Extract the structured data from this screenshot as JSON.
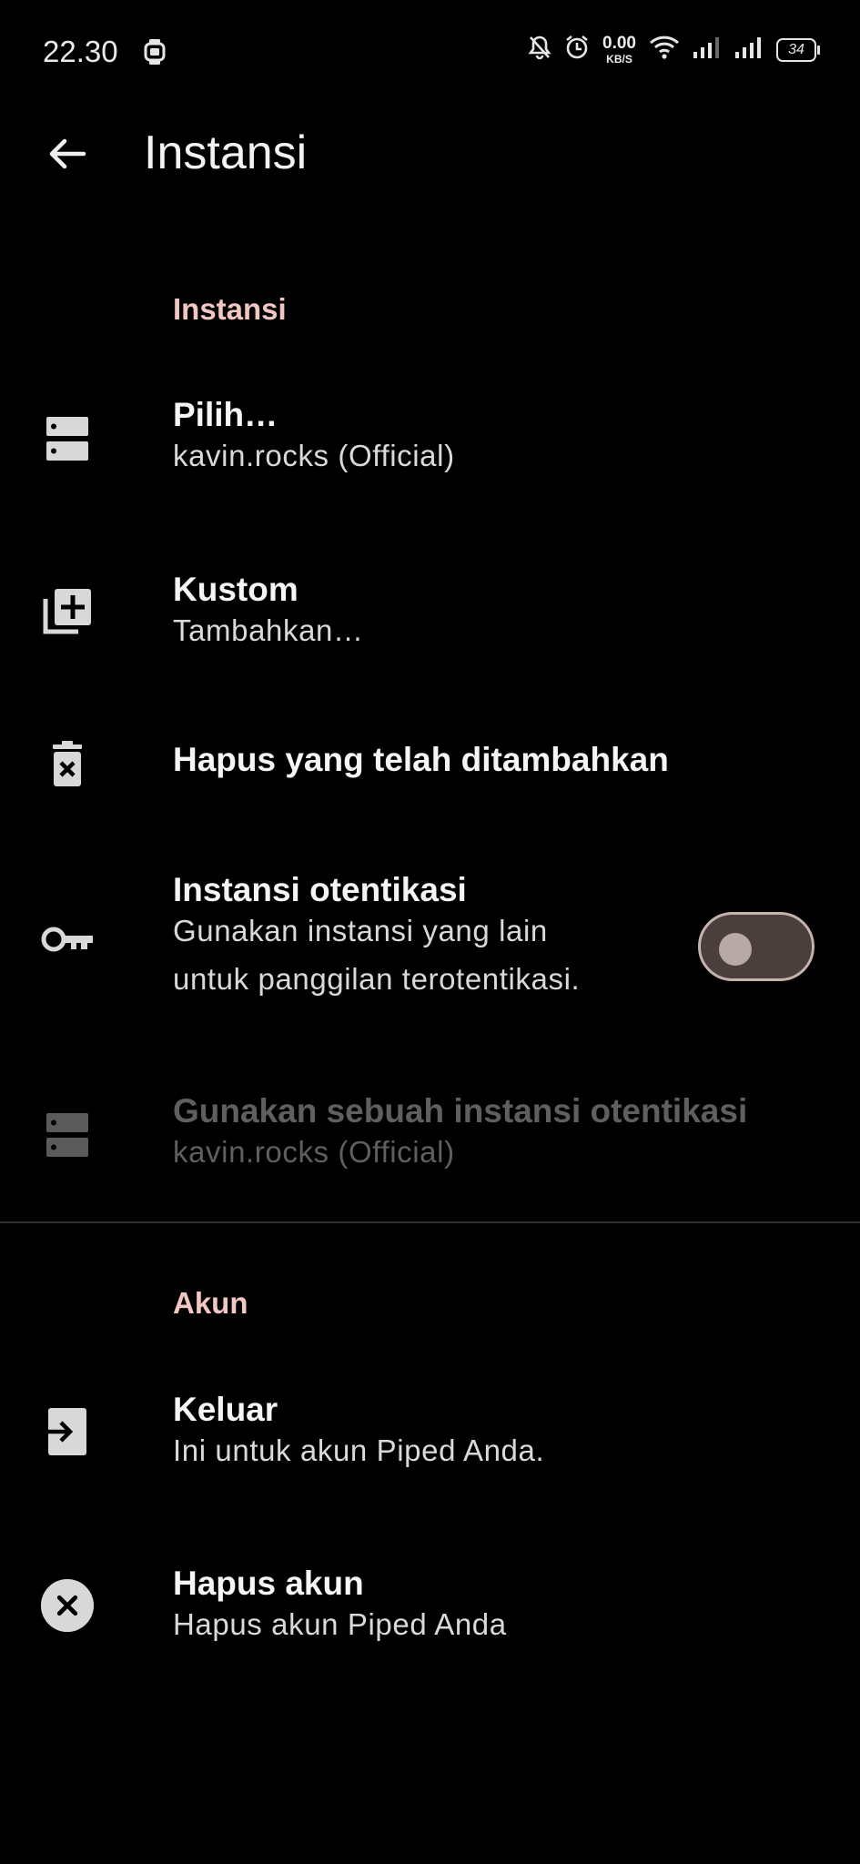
{
  "status_bar": {
    "time": "22.30",
    "net_speed_value": "0.00",
    "net_speed_unit": "KB/S",
    "battery": "34",
    "icons": [
      "watch-icon",
      "mute-icon",
      "alarm-icon",
      "wifi-icon",
      "signal-icon",
      "signal-icon"
    ]
  },
  "app_bar": {
    "title": "Instansi",
    "back_icon": "arrow-back-icon"
  },
  "sections": {
    "instance": {
      "header": "Instansi",
      "items": [
        {
          "title": "Pilih…",
          "summary": "kavin.rocks (Official)",
          "icon": "server-icon"
        },
        {
          "title": "Kustom",
          "summary": "Tambahkan…",
          "icon": "library-add-icon"
        },
        {
          "title": "Hapus yang telah ditambahkan",
          "icon": "delete-icon"
        },
        {
          "title": "Instansi otentikasi",
          "summary_line1": "Gunakan instansi yang lain",
          "summary_line2": "untuk panggilan terotentikasi.",
          "icon": "key-icon",
          "toggle_on": false
        },
        {
          "title": "Gunakan sebuah instansi otentikasi",
          "summary": "kavin.rocks (Official)",
          "icon": "server-icon",
          "enabled": false
        }
      ]
    },
    "account": {
      "header": "Akun",
      "items": [
        {
          "title": "Keluar",
          "summary": "Ini untuk akun Piped Anda.",
          "icon": "logout-icon"
        },
        {
          "title": "Hapus akun",
          "summary": "Hapus akun Piped Anda",
          "icon": "cancel-icon"
        }
      ]
    }
  },
  "colors": {
    "background": "#000000",
    "section_header": "#f2c7c2",
    "toggle_track": "#4a3f3d",
    "toggle_border": "#c6b2ad",
    "disabled_text": "#5f5f5f"
  }
}
